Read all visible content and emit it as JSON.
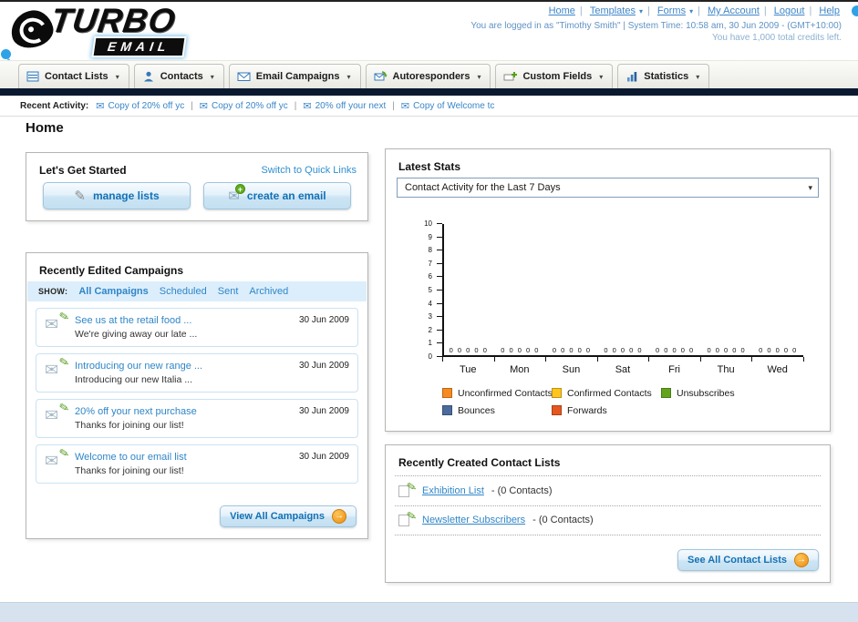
{
  "ui": {
    "separator": "|"
  },
  "icons": {
    "chevron_down": "▾",
    "envelope": "✉",
    "pencil": "✎",
    "plus": "+",
    "arrow_right": "→"
  },
  "app": {
    "logo_top": "TURBO",
    "logo_bottom": "EMAIL"
  },
  "header": {
    "links": [
      {
        "label": "Home"
      },
      {
        "label": "Templates"
      },
      {
        "label": "Forms"
      },
      {
        "label": "My Account"
      },
      {
        "label": "Logout"
      },
      {
        "label": "Help"
      }
    ],
    "login_info": "You are logged in as \"Timothy Smith\" | System Time: 10:58 am, 30 Jun 2009 - (GMT+10:00)",
    "credits": "You have 1,000 total credits left."
  },
  "nav": {
    "tabs": [
      {
        "label": "Contact Lists",
        "icon": "contact-lists-icon"
      },
      {
        "label": "Contacts",
        "icon": "contacts-icon"
      },
      {
        "label": "Email Campaigns",
        "icon": "email-campaigns-icon"
      },
      {
        "label": "Autoresponders",
        "icon": "autoresponders-icon"
      },
      {
        "label": "Custom Fields",
        "icon": "custom-fields-icon"
      },
      {
        "label": "Statistics",
        "icon": "statistics-icon"
      }
    ]
  },
  "recent_activity": {
    "label": "Recent Activity:",
    "items": [
      "Copy of 20% off yc",
      "Copy of 20% off yc",
      "20% off your next",
      "Copy of Welcome tc"
    ]
  },
  "main": {
    "page_title": "Home",
    "get_started": {
      "title": "Let's Get Started",
      "switch_link": "Switch to Quick Links",
      "manage_lists_label": "manage lists",
      "create_email_label": "create an email"
    },
    "campaigns": {
      "title": "Recently Edited Campaigns",
      "show_label": "SHOW:",
      "filters": [
        "All Campaigns",
        "Scheduled",
        "Sent",
        "Archived"
      ],
      "items": [
        {
          "title": "See us at the retail food ...",
          "subtitle": "We're giving away our late ...",
          "date": "30 Jun 2009"
        },
        {
          "title": "Introducing our new range ...",
          "subtitle": "Introducing our new Italia ...",
          "date": "30 Jun 2009"
        },
        {
          "title": "20% off your next purchase",
          "subtitle": "Thanks for joining our list!",
          "date": "30 Jun 2009"
        },
        {
          "title": "Welcome to our email list",
          "subtitle": "Thanks for joining our list!",
          "date": "30 Jun 2009"
        }
      ],
      "view_all_label": "View All Campaigns"
    },
    "stats": {
      "title": "Latest Stats",
      "dropdown_value": "Contact Activity for the Last 7 Days",
      "chart_data": {
        "type": "bar",
        "title": "Contact Activity for the Last 7 Days",
        "categories": [
          "Tue",
          "Mon",
          "Sun",
          "Sat",
          "Fri",
          "Thu",
          "Wed"
        ],
        "series": [
          {
            "name": "Unconfirmed Contacts",
            "color": "#f68b1f",
            "values": [
              0,
              0,
              0,
              0,
              0,
              0,
              0
            ]
          },
          {
            "name": "Confirmed Contacts",
            "color": "#fdc51d",
            "values": [
              0,
              0,
              0,
              0,
              0,
              0,
              0
            ]
          },
          {
            "name": "Unsubscribes",
            "color": "#63a41e",
            "values": [
              0,
              0,
              0,
              0,
              0,
              0,
              0
            ]
          },
          {
            "name": "Bounces",
            "color": "#4a6b9c",
            "values": [
              0,
              0,
              0,
              0,
              0,
              0,
              0
            ]
          },
          {
            "name": "Forwards",
            "color": "#e5571f",
            "values": [
              0,
              0,
              0,
              0,
              0,
              0,
              0
            ]
          }
        ],
        "ylim": [
          0,
          10
        ],
        "ytick_step": 1,
        "show_value_labels": true,
        "grid": false,
        "legend_position": "bottom",
        "legend_rows": [
          [
            "Unconfirmed Contacts",
            "Confirmed Contacts",
            "Unsubscribes"
          ],
          [
            "Bounces",
            "Forwards"
          ]
        ]
      }
    },
    "contact_lists": {
      "title": "Recently Created Contact Lists",
      "items": [
        {
          "name": "Exhibition List",
          "count": "- (0 Contacts)"
        },
        {
          "name": "Newsletter Subscribers",
          "count": "- (0 Contacts)"
        }
      ],
      "see_all_label": "See All Contact Lists"
    }
  }
}
